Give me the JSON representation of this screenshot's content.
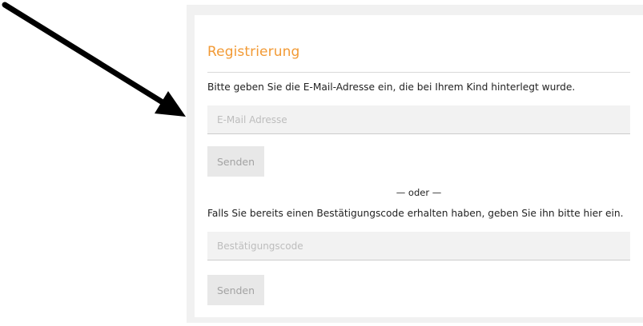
{
  "form": {
    "title": "Registrierung",
    "email_instruction": "Bitte geben Sie die E-Mail-Adresse ein, die bei Ihrem Kind hinterlegt wurde.",
    "email_placeholder": "E-Mail Adresse",
    "email_value": "",
    "email_submit_label": "Senden",
    "separator_text": "— oder —",
    "code_instruction": "Falls Sie bereits einen Bestätigungscode erhalten haben, geben Sie ihn bitte hier ein.",
    "code_placeholder": "Bestätigungscode",
    "code_value": "",
    "code_submit_label": "Senden"
  },
  "annotation": {
    "icon": "arrow-pointer-icon",
    "color": "#000000"
  },
  "colors": {
    "title": "#f29a35",
    "panel_background": "#f1f1f1",
    "input_background": "#f2f2f2",
    "button_background": "#e8e8e8",
    "button_text": "#a3a3a3"
  }
}
